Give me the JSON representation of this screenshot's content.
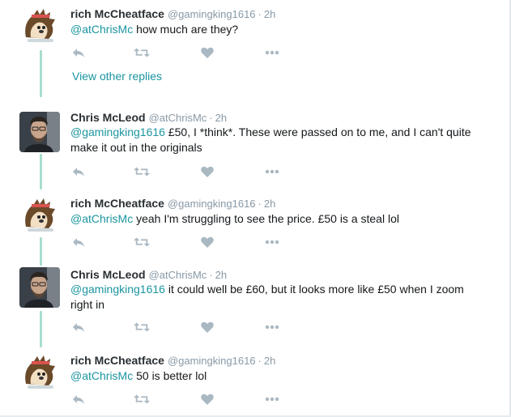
{
  "tweets": [
    {
      "name": "rich McCheatface",
      "handle": "@gamingking1616",
      "sep": "·",
      "time": "2h",
      "mention": "@atChrisMc",
      "text": " how much are they?",
      "avatar": "hedgehog"
    },
    {
      "name": "Chris McLeod",
      "handle": "@atChrisMc",
      "sep": "·",
      "time": "2h",
      "mention": "@gamingking1616",
      "text": " £50, I *think*. These were passed on to me, and I can't quite make it out in the originals",
      "avatar": "photo"
    },
    {
      "name": "rich McCheatface",
      "handle": "@gamingking1616",
      "sep": "·",
      "time": "2h",
      "mention": "@atChrisMc",
      "text": " yeah I'm struggling to see the price. £50 is a steal lol",
      "avatar": "hedgehog"
    },
    {
      "name": "Chris McLeod",
      "handle": "@atChrisMc",
      "sep": "·",
      "time": "2h",
      "mention": "@gamingking1616",
      "text": " it could well be £60, but it looks more like £50 when I zoom right in",
      "avatar": "photo"
    },
    {
      "name": "rich McCheatface",
      "handle": "@gamingking1616",
      "sep": "·",
      "time": "2h",
      "mention": "@atChrisMc",
      "text": " 50 is better lol",
      "avatar": "hedgehog"
    }
  ],
  "view_other_replies": "View other replies",
  "icons": {
    "reply": "reply-icon",
    "retweet": "retweet-icon",
    "like": "heart-icon",
    "more": "more-icon"
  },
  "colors": {
    "accent": "#1b95a0",
    "thread_line": "#a8ddd0",
    "icon": "#aab8c2"
  }
}
